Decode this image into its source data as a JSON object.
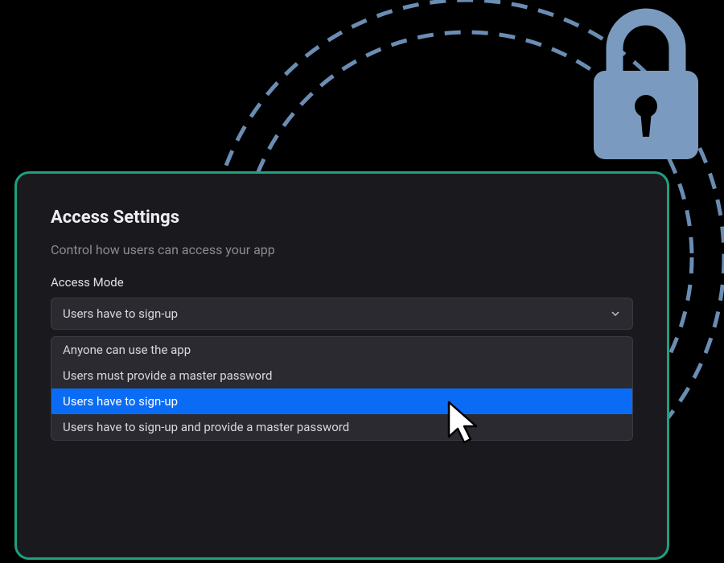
{
  "panel": {
    "title": "Access Settings",
    "subtitle": "Control how users can access your app"
  },
  "field": {
    "label": "Access Mode",
    "selected": "Users have to sign-up"
  },
  "options": [
    {
      "label": "Anyone can use the app",
      "selected": false
    },
    {
      "label": "Users must provide a master password",
      "selected": false
    },
    {
      "label": "Users have to sign-up",
      "selected": true
    },
    {
      "label": "Users have to sign-up and provide a master password",
      "selected": false
    }
  ],
  "colors": {
    "panelBorder": "#1ea07f",
    "panelBg": "#1a1a1e",
    "highlight": "#0a6cf5",
    "dashedCircle": "#6a8db3",
    "lockFill": "#7a9bbf"
  }
}
